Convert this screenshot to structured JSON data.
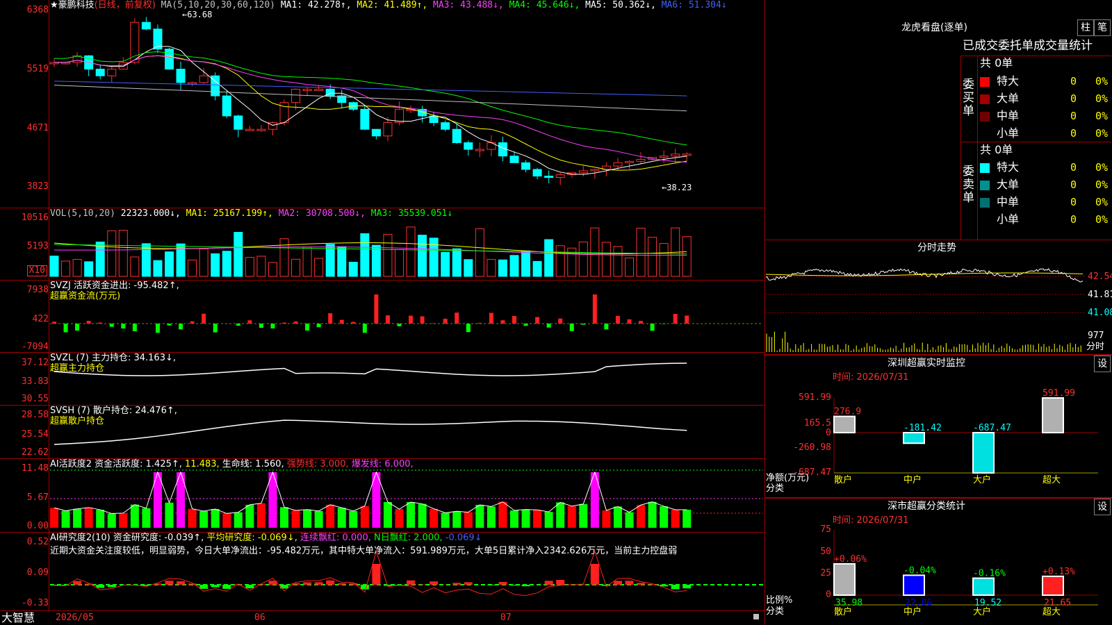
{
  "app": {
    "stock_name": "★豪鹏科技",
    "chart_mode": "(日线，前复权)",
    "brand": "大智慧"
  },
  "main": {
    "ma_label": "MA(5,10,20,30,60,120)",
    "ma1": "MA1: 42.278↑,",
    "ma2": "MA2: 41.489↑,",
    "ma3": "MA3: 43.488↓,",
    "ma4": "MA4: 45.646↓,",
    "ma5": "MA5: 50.362↓,",
    "ma6": "MA6: 51.304↓",
    "high_note": "←63.68",
    "low_note": "←38.23",
    "yticks": [
      "6368",
      "5519",
      "4671",
      "3823"
    ]
  },
  "vol": {
    "label": "VOL(5,10,20)",
    "value": "22323.000↓,",
    "ma1": "MA1: 25167.199↑,",
    "ma2": "MA2: 30708.500↓,",
    "ma3": "MA3: 35539.051↓",
    "yticks": [
      "10516",
      "5193"
    ],
    "unit": "X10"
  },
  "svzj": {
    "label": "SVZJ  活跃资金进出: -95.482↑,",
    "sub": "超赢资金流(万元)",
    "yticks": [
      "7938",
      "422",
      "-7094"
    ]
  },
  "svzl": {
    "label": "SVZL (7) 主力持仓: 34.163↓,",
    "sub": "超赢主力持仓",
    "yticks": [
      "37.12",
      "33.83",
      "30.55"
    ]
  },
  "svsh": {
    "label": "SVSH (7) 散户持仓: 24.476↑,",
    "sub": "超赢散户持仓",
    "yticks": [
      "28.58",
      "25.54",
      "22.62"
    ]
  },
  "ai1": {
    "label": "AI活跃度2 资金活跃度: 1.425↑,",
    "v2": "11.483,",
    "v3": "生命线: 1.560,",
    "v4": "强势线: 3.000,",
    "v5": "爆发线: 6.000,",
    "yticks": [
      "11.48",
      "5.67",
      "0.00"
    ]
  },
  "ai2": {
    "label": "AI研究度2(10) 资金研究度: -0.039↑,",
    "v2": "平均研究度: -0.069↓,",
    "v3": "连续飘红: 0.000,",
    "v4": "N日飘红: 2.000,",
    "v5": "-0.069↓",
    "comment": "近期大资金关注度较低，明显弱势，今日大单净流出：-95.482万元，其中特大单净流入：591.989万元，大单5日累计净入2342.626万元，当前主力控盘弱",
    "yticks": [
      "0.52",
      "0.09",
      "-0.33"
    ]
  },
  "xaxis": [
    "2026/05",
    "06",
    "07"
  ],
  "lhb": {
    "title": "龙虎看盘(逐单)",
    "btn1": "柱",
    "btn2": "笔",
    "subtitle": "已成交委托单成交量统计",
    "buy_label": "委买单",
    "sell_label": "委卖单",
    "buy_total": "共 0单",
    "sell_total": "共 0单",
    "buy_rows": [
      {
        "name": "特大",
        "count": "0",
        "pct": "0%",
        "color": "#ff0000"
      },
      {
        "name": "大单",
        "count": "0",
        "pct": "0%",
        "color": "#a00000"
      },
      {
        "name": "中单",
        "count": "0",
        "pct": "0%",
        "color": "#700000"
      },
      {
        "name": "小单",
        "count": "0",
        "pct": "0%",
        "color": ""
      }
    ],
    "sell_rows": [
      {
        "name": "特大",
        "count": "0",
        "pct": "0%",
        "color": "#00ffff"
      },
      {
        "name": "大单",
        "count": "0",
        "pct": "0%",
        "color": "#009090"
      },
      {
        "name": "中单",
        "count": "0",
        "pct": "0%",
        "color": "#007070"
      },
      {
        "name": "小单",
        "count": "0",
        "pct": "0%",
        "color": ""
      }
    ]
  },
  "fenshi": {
    "title": "分时走势",
    "yticks": [
      "42.54",
      "41.81",
      "41.08",
      "977"
    ],
    "footer": "分时"
  },
  "sz_monitor": {
    "title": "深圳超赢实时监控",
    "btn": "设",
    "time": "时间: 2026/07/31",
    "yticks": [
      "591.99",
      "165.5",
      "0",
      "-260.98",
      "-687.47"
    ],
    "ylabel": "净额(万元)",
    "xlabel": "分类",
    "chart_data": {
      "type": "bar",
      "categories": [
        "散户",
        "中户",
        "大户",
        "超大"
      ],
      "values": [
        276.9,
        -181.42,
        -687.47,
        591.99
      ],
      "value_labels": [
        "276.9",
        "-181.42",
        "-687.47",
        "591.99"
      ],
      "ylim": [
        -687.47,
        591.99
      ]
    }
  },
  "sh_stats": {
    "title": "深市超赢分类统计",
    "btn": "设",
    "time": "时间: 2026/07/31",
    "yticks": [
      "75",
      "50",
      "25",
      "0"
    ],
    "ylabel": "比例%",
    "xlabel": "分类",
    "chart_data": {
      "type": "bar",
      "categories": [
        "散户",
        "中户",
        "大户",
        "超大"
      ],
      "values": [
        35.98,
        22.86,
        19.52,
        21.65
      ],
      "change_labels": [
        "+0.06%",
        "-0.04%",
        "-0.16%",
        "+0.13%"
      ],
      "value_labels": [
        "35.98",
        "22.86",
        "19.52",
        "21.65"
      ],
      "ylim": [
        0,
        75
      ]
    }
  }
}
